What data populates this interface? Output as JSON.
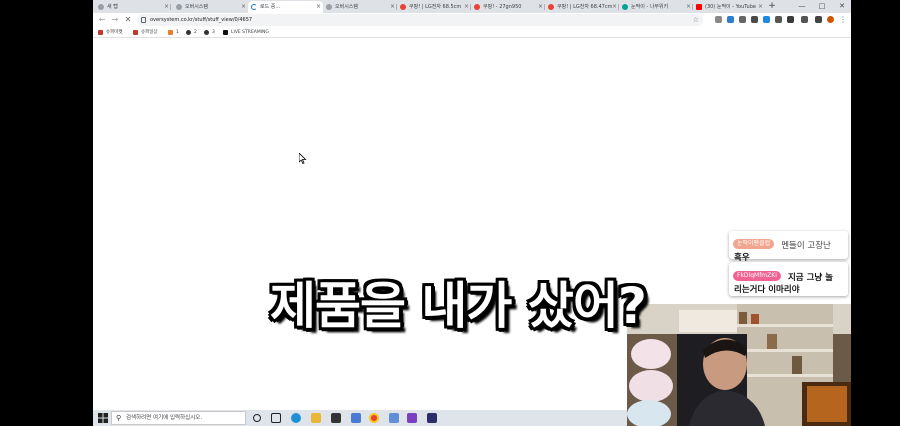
{
  "browser": {
    "tabs": [
      {
        "label": "새 탭",
        "favicon_color": "#9aa0a6",
        "active": false
      },
      {
        "label": "오버시스템",
        "favicon_color": "#9aa0a6",
        "active": false
      },
      {
        "label": "로드 중...",
        "favicon_color": "#1a73e8",
        "active": true
      },
      {
        "label": "오버시스템",
        "favicon_color": "#9aa0a6",
        "active": false
      },
      {
        "label": "쿠팡! | LG전자 68.5cm",
        "favicon_color": "#e94235",
        "active": false
      },
      {
        "label": "쿠팡! - 27gn950",
        "favicon_color": "#e94235",
        "active": false
      },
      {
        "label": "쿠팡! | LG전자 68.47cm",
        "favicon_color": "#e94235",
        "active": false
      },
      {
        "label": "눈딱이 - 나무위키",
        "favicon_color": "#00a495",
        "active": false
      },
      {
        "label": "(30) 눈딱이 - YouTube",
        "favicon_color": "#ff0000",
        "active": false
      }
    ],
    "window_controls": [
      "—",
      "□",
      "✕"
    ],
    "url": "oversystem.co.kr/stuff/stuff_view/0/4657",
    "bookmarks": [
      {
        "label": "슈퍼마켓",
        "favicon_color": "#c0392b"
      },
      {
        "label": "슈퍼일상",
        "favicon_color": "#c0392b"
      },
      {
        "label": "1",
        "favicon_color": "#e67e22"
      },
      {
        "label": "2",
        "favicon_color": "#333333"
      },
      {
        "label": "3",
        "favicon_color": "#333333"
      },
      {
        "label": "LIVE STREAMING",
        "favicon_color": "#111111"
      }
    ]
  },
  "taskbar": {
    "search_placeholder": "검색하려면 여기에 입력하십시오."
  },
  "chat": {
    "message1": {
      "user": "눈딱이팬클럽",
      "text1": "멘들이 고장난",
      "text2": "흑우",
      "chip_color": "#f2a58e"
    },
    "message2": {
      "user": "FkDlqMfmZKi",
      "text1": "지금 그냥 놀",
      "text2": "리는거다 이마리야",
      "chip_color": "#f06292"
    }
  },
  "subtitle": "제품을 내가 샀어?"
}
